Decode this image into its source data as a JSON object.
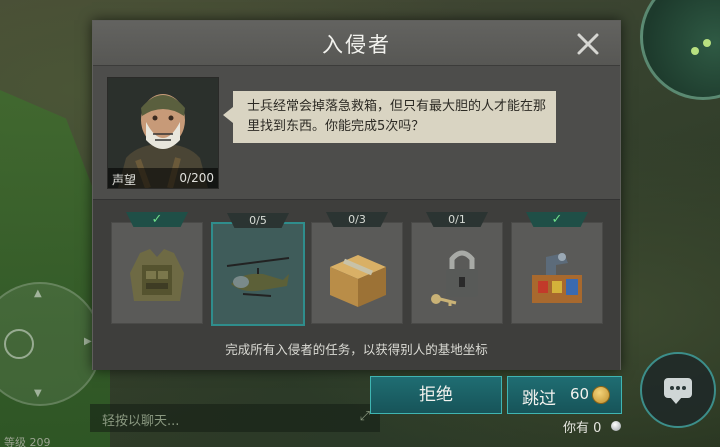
{
  "dialog": {
    "title": "入侵者",
    "speech": "士兵经常会掉落急救箱，但只有最大胆的人才能在那里找到东西。你能完成5次吗？",
    "portrait": {
      "label": "声望",
      "value": "0/200"
    },
    "tasks": [
      {
        "name": "armor-vest-icon",
        "badge": "✓",
        "done": true
      },
      {
        "name": "helicopter-icon",
        "badge": "0/5",
        "done": false,
        "selected": true
      },
      {
        "name": "cardboard-box-icon",
        "badge": "0/3",
        "done": false
      },
      {
        "name": "padlock-key-icon",
        "badge": "0/1",
        "done": false
      },
      {
        "name": "workbench-icon",
        "badge": "✓",
        "done": true
      }
    ],
    "footer_note": "完成所有入侵者的任务，以获得别人的基地坐标"
  },
  "buttons": {
    "refuse_label": "拒绝",
    "skip_label": "跳过",
    "skip_cost": "60"
  },
  "balance": {
    "label": "你有",
    "value": "0"
  },
  "hud": {
    "chat_placeholder": "轻按以聊天...",
    "level_text": "等级 209"
  },
  "colors": {
    "accent": "#2f8d8c",
    "done_check": "#6ee08a",
    "panel": "#4d4d4b"
  }
}
